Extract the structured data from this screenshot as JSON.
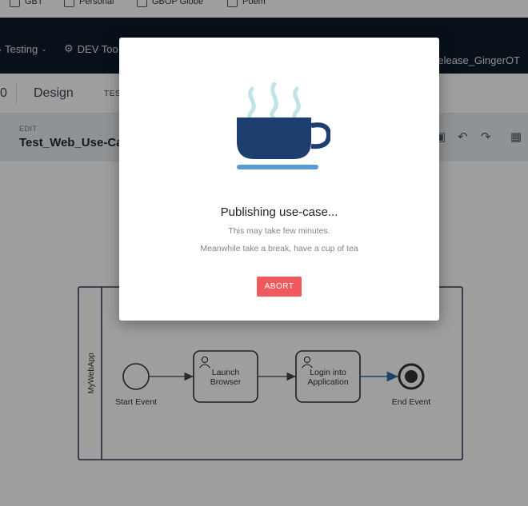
{
  "bookmarks": [
    {
      "label": "GBT"
    },
    {
      "label": "Personal"
    },
    {
      "label": "GBOP Globe"
    },
    {
      "label": "Poem"
    }
  ],
  "navbar": {
    "testing_label": "Testing",
    "dev_tools_label": "DEV Too",
    "release_label": "st Release_GingerOT"
  },
  "tabs": {
    "prev_fragment": "0",
    "design": "Design",
    "test_fragment": "TES"
  },
  "editor": {
    "edit_label": "EDIT",
    "title": "Test_Web_Use-Ca"
  },
  "diagram": {
    "pool_label": "MyWebApp",
    "start_event": "Start Event",
    "task1_line1": "Launch",
    "task1_line2": "Browser",
    "task2_line1": "Login into",
    "task2_line2": "Application",
    "end_event": "End Event"
  },
  "modal": {
    "title": "Publishing use-case...",
    "subtitle": "This may take few minutes.",
    "subtitle2": "Meanwhile take a break, have a cup of tea",
    "abort_label": "ABORT"
  },
  "colors": {
    "navbar_bg": "#0d1b2a",
    "cup": "#1f3e70",
    "saucer": "#5b9bd5",
    "steam": "#bfe3e6",
    "abort_bg": "#f05a5f",
    "flow_highlight": "#2f6fb0"
  },
  "icons": {
    "testing": "wifi-icon",
    "dev_tools": "gears-icon",
    "undo": "undo-icon",
    "redo": "redo-icon",
    "map": "map-icon",
    "save": "save-icon",
    "user_task": "user-icon",
    "cup": "tea-cup-icon"
  }
}
